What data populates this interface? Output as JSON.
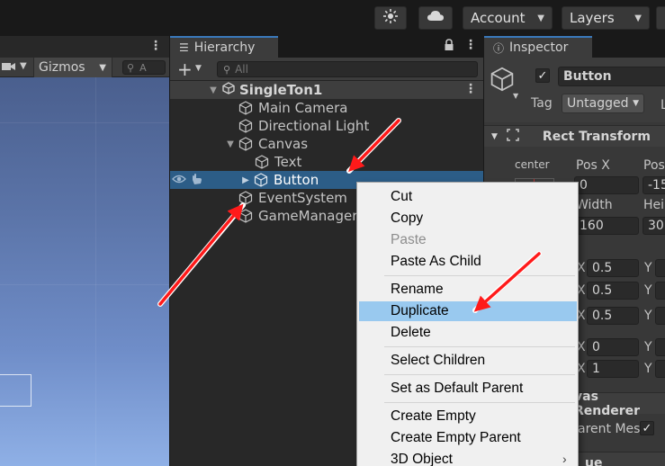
{
  "toolbar": {
    "account_label": "Account",
    "layers_label": "Layers",
    "icons": [
      "services-icon",
      "cloud-icon"
    ]
  },
  "scene": {
    "gizmos_label": "Gizmos",
    "search_placeholder": "A"
  },
  "hierarchy": {
    "tab_label": "Hierarchy",
    "search_placeholder": "All",
    "scene_name": "SingleTon1",
    "items": [
      {
        "label": "Main Camera",
        "depth": 1
      },
      {
        "label": "Directional Light",
        "depth": 1
      },
      {
        "label": "Canvas",
        "depth": 1,
        "expanded": true
      },
      {
        "label": "Text",
        "depth": 2
      },
      {
        "label": "Button",
        "depth": 2,
        "selected": true,
        "collapsed": true
      },
      {
        "label": "EventSystem",
        "depth": 1
      },
      {
        "label": "GameManager",
        "depth": 1
      }
    ]
  },
  "inspector": {
    "tab_label": "Inspector",
    "object_name": "Button",
    "active": true,
    "tag_label": "Tag",
    "tag_value": "Untagged",
    "layer_label_partial": "L",
    "rect_transform_title": "Rect Transform",
    "anchor_label": "center",
    "posx_label": "Pos X",
    "posy_label_partial": "Pos",
    "posx_value": "0",
    "posy_value_partial": "-15",
    "width_label": "Width",
    "height_label_partial": "Hei",
    "width_value": "160",
    "height_value_partial": "30",
    "anchor_rows": [
      {
        "x_label": "X",
        "x_value": "0.5",
        "y_label": "Y"
      },
      {
        "x_label": "X",
        "x_value": "0.5",
        "y_label": "Y"
      },
      {
        "x_label": "X",
        "x_value": "0.5",
        "y_label": "Y"
      }
    ],
    "rot_rows": [
      {
        "x_label": "X",
        "x_value": "0",
        "y_label": "Y"
      },
      {
        "x_label": "X",
        "x_value": "1",
        "y_label": "Y"
      }
    ],
    "canvas_renderer_partial": "vas Renderer",
    "cull_label_partial": "arent Mes",
    "bottom_partial": "ue"
  },
  "context_menu": {
    "items": [
      {
        "label": "Cut",
        "enabled": true
      },
      {
        "label": "Copy",
        "enabled": true
      },
      {
        "label": "Paste",
        "enabled": false
      },
      {
        "label": "Paste As Child",
        "enabled": true
      },
      {
        "label": "Rename",
        "enabled": true
      },
      {
        "label": "Duplicate",
        "enabled": true,
        "highlighted": true
      },
      {
        "label": "Delete",
        "enabled": true
      },
      {
        "label": "Select Children",
        "enabled": true
      },
      {
        "label": "Set as Default Parent",
        "enabled": true
      },
      {
        "label": "Create Empty",
        "enabled": true
      },
      {
        "label": "Create Empty Parent",
        "enabled": true
      },
      {
        "label": "3D Object",
        "enabled": true,
        "has_submenu": true
      }
    ]
  },
  "colors": {
    "selection": "#2c5d87",
    "menu_highlight": "#99c9ef",
    "annotation_arrow": "#ff1a1a",
    "tab_accent": "#3a79bb"
  }
}
